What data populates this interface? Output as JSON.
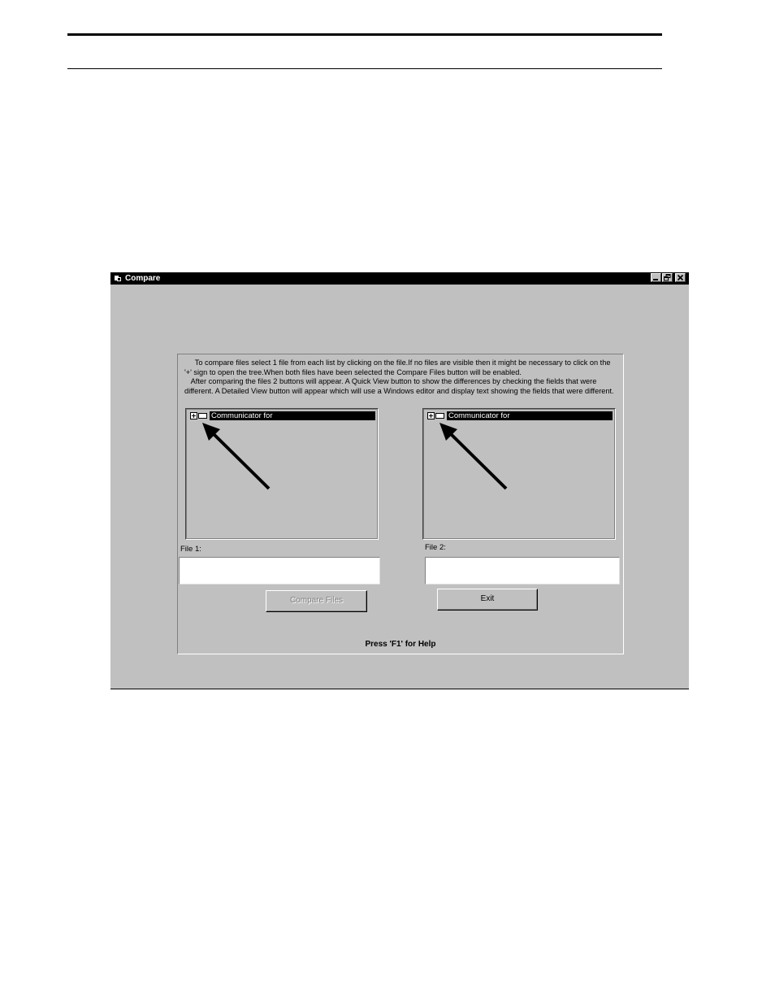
{
  "window": {
    "title": "Compare"
  },
  "instructions": {
    "paragraph1": "     To compare files select 1 file from each list by clicking on the file.If no files are visible then it might be necessary to click on the '+' sign to open the tree.When both files have been selected the Compare Files button will be enabled.",
    "paragraph2": "   After comparing the files 2 buttons will appear. A Quick View button to show the differences by checking the fields that were different. A Detailed View button will appear which will use a Windows editor and display text showing the fields that were different."
  },
  "left_tree": {
    "node_label": "Communicator for"
  },
  "right_tree": {
    "node_label": "Communicator for"
  },
  "file1": {
    "label": "File 1:",
    "value": ""
  },
  "file2": {
    "label": "File 2:",
    "value": ""
  },
  "buttons": {
    "compare_label": "Compare Files",
    "compare_enabled": false,
    "exit_label": "Exit"
  },
  "help_text": "Press 'F1' for Help",
  "icons": {
    "title_icon": "app-icon",
    "minimize": "minimize-icon",
    "restore": "restore-icon",
    "close": "close-icon",
    "expand": "plus-expand-icon",
    "folder": "folder-icon",
    "annotation": "arrow-icon"
  }
}
